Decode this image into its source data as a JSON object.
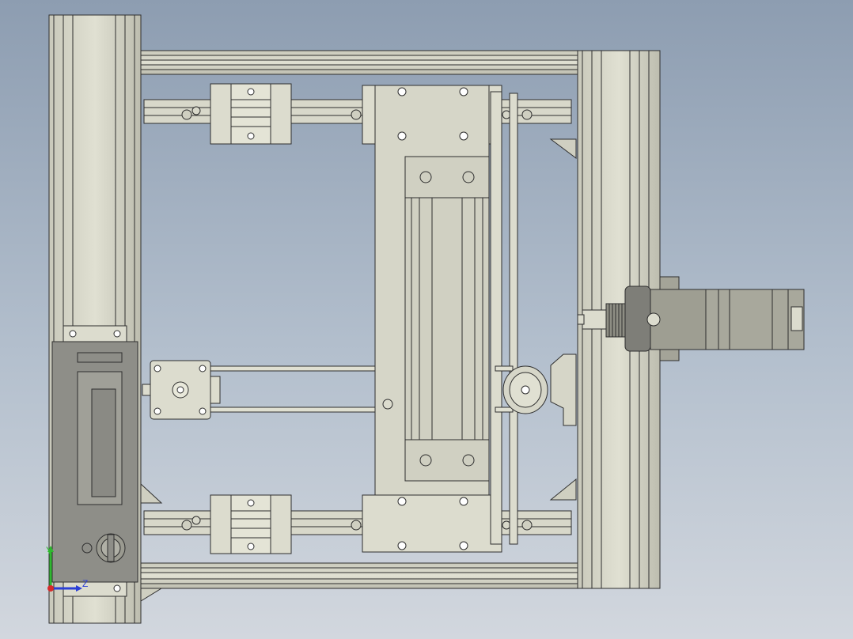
{
  "viewport": {
    "background_top": "#8d9db1",
    "background_bottom": "#d2d7de",
    "part_fill": "#d6d6c8",
    "part_shadow": "#a8a89a",
    "edge_color": "#2e2e2e",
    "panel_fill": "#8e8e88"
  },
  "triad": {
    "y_label": "Y",
    "z_label": "Z",
    "y_color": "#2fb82f",
    "z_color": "#2b3fd6",
    "x_color": "#d62b2b"
  }
}
